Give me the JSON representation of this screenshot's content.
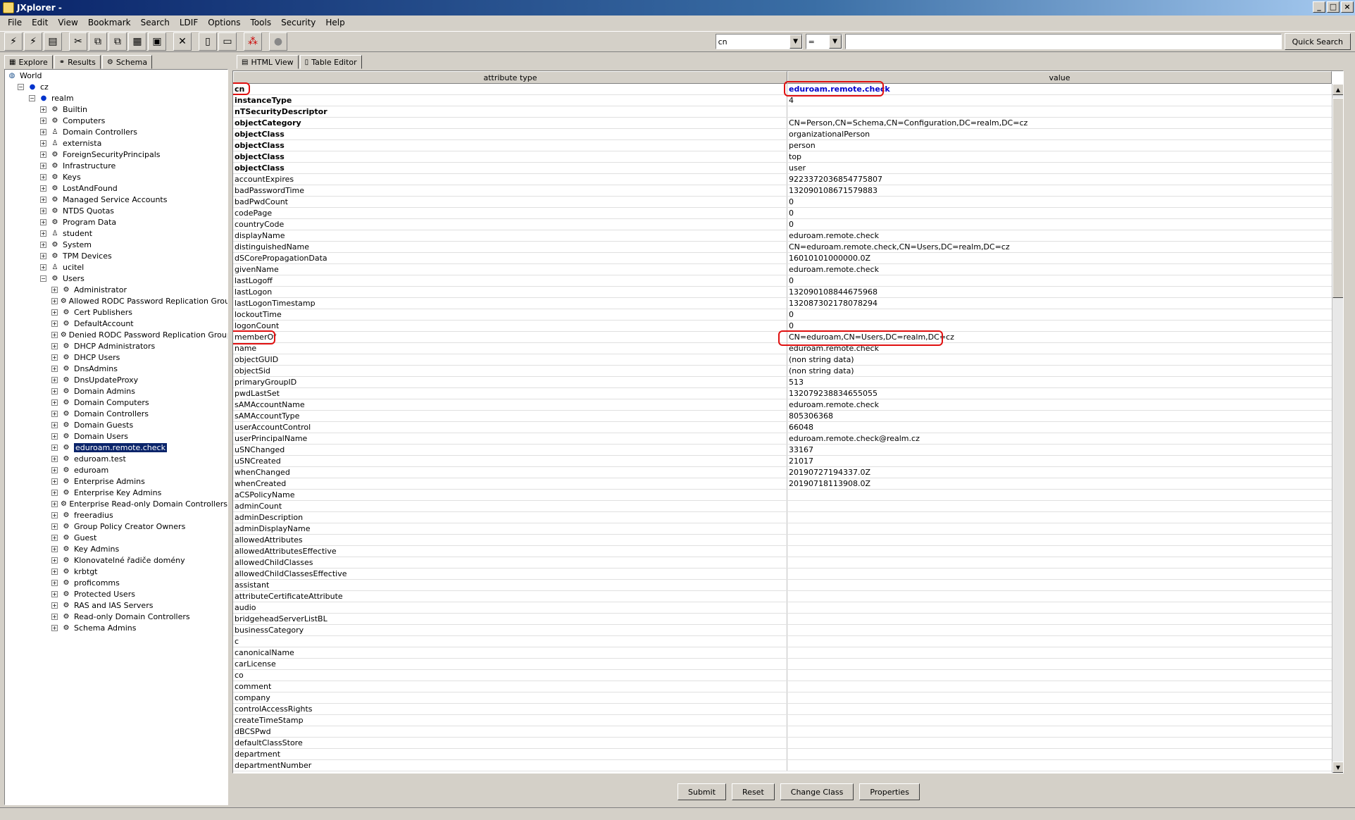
{
  "window": {
    "title": "JXplorer -"
  },
  "menu": [
    "File",
    "Edit",
    "View",
    "Bookmark",
    "Search",
    "LDIF",
    "Options",
    "Tools",
    "Security",
    "Help"
  ],
  "search": {
    "attribute": "cn",
    "operator": "=",
    "value": "",
    "button": "Quick Search"
  },
  "left_tabs": [
    "Explore",
    "Results",
    "Schema"
  ],
  "right_tabs": [
    "HTML View",
    "Table Editor"
  ],
  "tree": [
    {
      "label": "World",
      "depth": 0,
      "toggle": "",
      "icon": "globe-icon"
    },
    {
      "label": "cz",
      "depth": 1,
      "toggle": "−",
      "icon": "dot-icon"
    },
    {
      "label": "realm",
      "depth": 2,
      "toggle": "−",
      "icon": "dot-icon"
    },
    {
      "label": "Builtin",
      "depth": 3,
      "toggle": "+",
      "icon": "folder-icon"
    },
    {
      "label": "Computers",
      "depth": 3,
      "toggle": "+",
      "icon": "folder-icon"
    },
    {
      "label": "Domain Controllers",
      "depth": 3,
      "toggle": "+",
      "icon": "ou-icon"
    },
    {
      "label": "externista",
      "depth": 3,
      "toggle": "+",
      "icon": "ou-icon"
    },
    {
      "label": "ForeignSecurityPrincipals",
      "depth": 3,
      "toggle": "+",
      "icon": "folder-icon"
    },
    {
      "label": "Infrastructure",
      "depth": 3,
      "toggle": "+",
      "icon": "folder-icon"
    },
    {
      "label": "Keys",
      "depth": 3,
      "toggle": "+",
      "icon": "folder-icon"
    },
    {
      "label": "LostAndFound",
      "depth": 3,
      "toggle": "+",
      "icon": "folder-icon"
    },
    {
      "label": "Managed Service Accounts",
      "depth": 3,
      "toggle": "+",
      "icon": "folder-icon"
    },
    {
      "label": "NTDS Quotas",
      "depth": 3,
      "toggle": "+",
      "icon": "folder-icon"
    },
    {
      "label": "Program Data",
      "depth": 3,
      "toggle": "+",
      "icon": "folder-icon"
    },
    {
      "label": "student",
      "depth": 3,
      "toggle": "+",
      "icon": "ou-icon"
    },
    {
      "label": "System",
      "depth": 3,
      "toggle": "+",
      "icon": "folder-icon"
    },
    {
      "label": "TPM Devices",
      "depth": 3,
      "toggle": "+",
      "icon": "folder-icon"
    },
    {
      "label": "ucitel",
      "depth": 3,
      "toggle": "+",
      "icon": "ou-icon"
    },
    {
      "label": "Users",
      "depth": 3,
      "toggle": "−",
      "icon": "folder-icon"
    },
    {
      "label": "Administrator",
      "depth": 4,
      "toggle": "+",
      "icon": "user-icon"
    },
    {
      "label": "Allowed RODC Password Replication Group",
      "depth": 4,
      "toggle": "+",
      "icon": "user-icon"
    },
    {
      "label": "Cert Publishers",
      "depth": 4,
      "toggle": "+",
      "icon": "user-icon"
    },
    {
      "label": "DefaultAccount",
      "depth": 4,
      "toggle": "+",
      "icon": "user-icon"
    },
    {
      "label": "Denied RODC Password Replication Group",
      "depth": 4,
      "toggle": "+",
      "icon": "user-icon"
    },
    {
      "label": "DHCP Administrators",
      "depth": 4,
      "toggle": "+",
      "icon": "user-icon"
    },
    {
      "label": "DHCP Users",
      "depth": 4,
      "toggle": "+",
      "icon": "user-icon"
    },
    {
      "label": "DnsAdmins",
      "depth": 4,
      "toggle": "+",
      "icon": "user-icon"
    },
    {
      "label": "DnsUpdateProxy",
      "depth": 4,
      "toggle": "+",
      "icon": "user-icon"
    },
    {
      "label": "Domain Admins",
      "depth": 4,
      "toggle": "+",
      "icon": "user-icon"
    },
    {
      "label": "Domain Computers",
      "depth": 4,
      "toggle": "+",
      "icon": "user-icon"
    },
    {
      "label": "Domain Controllers",
      "depth": 4,
      "toggle": "+",
      "icon": "user-icon"
    },
    {
      "label": "Domain Guests",
      "depth": 4,
      "toggle": "+",
      "icon": "user-icon"
    },
    {
      "label": "Domain Users",
      "depth": 4,
      "toggle": "+",
      "icon": "user-icon"
    },
    {
      "label": "eduroam.remote.check",
      "depth": 4,
      "toggle": "+",
      "icon": "user-icon",
      "selected": true
    },
    {
      "label": "eduroam.test",
      "depth": 4,
      "toggle": "+",
      "icon": "user-icon"
    },
    {
      "label": "eduroam",
      "depth": 4,
      "toggle": "+",
      "icon": "user-icon"
    },
    {
      "label": "Enterprise Admins",
      "depth": 4,
      "toggle": "+",
      "icon": "user-icon"
    },
    {
      "label": "Enterprise Key Admins",
      "depth": 4,
      "toggle": "+",
      "icon": "user-icon"
    },
    {
      "label": "Enterprise Read-only Domain Controllers",
      "depth": 4,
      "toggle": "+",
      "icon": "user-icon"
    },
    {
      "label": "freeradius",
      "depth": 4,
      "toggle": "+",
      "icon": "user-icon"
    },
    {
      "label": "Group Policy Creator Owners",
      "depth": 4,
      "toggle": "+",
      "icon": "user-icon"
    },
    {
      "label": "Guest",
      "depth": 4,
      "toggle": "+",
      "icon": "user-icon"
    },
    {
      "label": "Key Admins",
      "depth": 4,
      "toggle": "+",
      "icon": "user-icon"
    },
    {
      "label": "Klonovatelné řadiče domény",
      "depth": 4,
      "toggle": "+",
      "icon": "user-icon"
    },
    {
      "label": "krbtgt",
      "depth": 4,
      "toggle": "+",
      "icon": "user-icon"
    },
    {
      "label": "proficomms",
      "depth": 4,
      "toggle": "+",
      "icon": "user-icon"
    },
    {
      "label": "Protected Users",
      "depth": 4,
      "toggle": "+",
      "icon": "user-icon"
    },
    {
      "label": "RAS and IAS Servers",
      "depth": 4,
      "toggle": "+",
      "icon": "user-icon"
    },
    {
      "label": "Read-only Domain Controllers",
      "depth": 4,
      "toggle": "+",
      "icon": "user-icon"
    },
    {
      "label": "Schema Admins",
      "depth": 4,
      "toggle": "+",
      "icon": "user-icon"
    }
  ],
  "table": {
    "headers": [
      "attribute type",
      "value"
    ],
    "rows": [
      {
        "attr": "cn",
        "value": "eduroam.remote.check",
        "bold": true,
        "link": true
      },
      {
        "attr": "instanceType",
        "value": "4",
        "bold": true
      },
      {
        "attr": "nTSecurityDescriptor",
        "value": "",
        "bold": true
      },
      {
        "attr": "objectCategory",
        "value": "CN=Person,CN=Schema,CN=Configuration,DC=realm,DC=cz",
        "bold": true
      },
      {
        "attr": "objectClass",
        "value": "organizationalPerson",
        "bold": true
      },
      {
        "attr": "objectClass",
        "value": "person",
        "bold": true
      },
      {
        "attr": "objectClass",
        "value": "top",
        "bold": true
      },
      {
        "attr": "objectClass",
        "value": "user",
        "bold": true
      },
      {
        "attr": "accountExpires",
        "value": "9223372036854775807"
      },
      {
        "attr": "badPasswordTime",
        "value": "132090108671579883"
      },
      {
        "attr": "badPwdCount",
        "value": "0"
      },
      {
        "attr": "codePage",
        "value": "0"
      },
      {
        "attr": "countryCode",
        "value": "0"
      },
      {
        "attr": "displayName",
        "value": "eduroam.remote.check"
      },
      {
        "attr": "distinguishedName",
        "value": "CN=eduroam.remote.check,CN=Users,DC=realm,DC=cz"
      },
      {
        "attr": "dSCorePropagationData",
        "value": "16010101000000.0Z"
      },
      {
        "attr": "givenName",
        "value": "eduroam.remote.check"
      },
      {
        "attr": "lastLogoff",
        "value": "0"
      },
      {
        "attr": "lastLogon",
        "value": "132090108844675968"
      },
      {
        "attr": "lastLogonTimestamp",
        "value": "132087302178078294"
      },
      {
        "attr": "lockoutTime",
        "value": "0"
      },
      {
        "attr": "logonCount",
        "value": "0"
      },
      {
        "attr": "memberOf",
        "value": "CN=eduroam,CN=Users,DC=realm,DC=cz"
      },
      {
        "attr": "name",
        "value": "eduroam.remote.check"
      },
      {
        "attr": "objectGUID",
        "value": "(non string data)"
      },
      {
        "attr": "objectSid",
        "value": "(non string data)"
      },
      {
        "attr": "primaryGroupID",
        "value": "513"
      },
      {
        "attr": "pwdLastSet",
        "value": "132079238834655055"
      },
      {
        "attr": "sAMAccountName",
        "value": "eduroam.remote.check"
      },
      {
        "attr": "sAMAccountType",
        "value": "805306368"
      },
      {
        "attr": "userAccountControl",
        "value": "66048"
      },
      {
        "attr": "userPrincipalName",
        "value": "eduroam.remote.check@realm.cz"
      },
      {
        "attr": "uSNChanged",
        "value": "33167"
      },
      {
        "attr": "uSNCreated",
        "value": "21017"
      },
      {
        "attr": "whenChanged",
        "value": "20190727194337.0Z"
      },
      {
        "attr": "whenCreated",
        "value": "20190718113908.0Z"
      },
      {
        "attr": "aCSPolicyName",
        "value": ""
      },
      {
        "attr": "adminCount",
        "value": ""
      },
      {
        "attr": "adminDescription",
        "value": ""
      },
      {
        "attr": "adminDisplayName",
        "value": ""
      },
      {
        "attr": "allowedAttributes",
        "value": ""
      },
      {
        "attr": "allowedAttributesEffective",
        "value": ""
      },
      {
        "attr": "allowedChildClasses",
        "value": ""
      },
      {
        "attr": "allowedChildClassesEffective",
        "value": ""
      },
      {
        "attr": "assistant",
        "value": ""
      },
      {
        "attr": "attributeCertificateAttribute",
        "value": ""
      },
      {
        "attr": "audio",
        "value": ""
      },
      {
        "attr": "bridgeheadServerListBL",
        "value": ""
      },
      {
        "attr": "businessCategory",
        "value": ""
      },
      {
        "attr": "c",
        "value": ""
      },
      {
        "attr": "canonicalName",
        "value": ""
      },
      {
        "attr": "carLicense",
        "value": ""
      },
      {
        "attr": "co",
        "value": ""
      },
      {
        "attr": "comment",
        "value": ""
      },
      {
        "attr": "company",
        "value": ""
      },
      {
        "attr": "controlAccessRights",
        "value": ""
      },
      {
        "attr": "createTimeStamp",
        "value": ""
      },
      {
        "attr": "dBCSPwd",
        "value": ""
      },
      {
        "attr": "defaultClassStore",
        "value": ""
      },
      {
        "attr": "department",
        "value": ""
      },
      {
        "attr": "departmentNumber",
        "value": ""
      }
    ]
  },
  "buttons": [
    "Submit",
    "Reset",
    "Change Class",
    "Properties"
  ],
  "colors": {
    "selection": "#0a246a",
    "highlight": "#e01010",
    "link": "#0000cc"
  }
}
